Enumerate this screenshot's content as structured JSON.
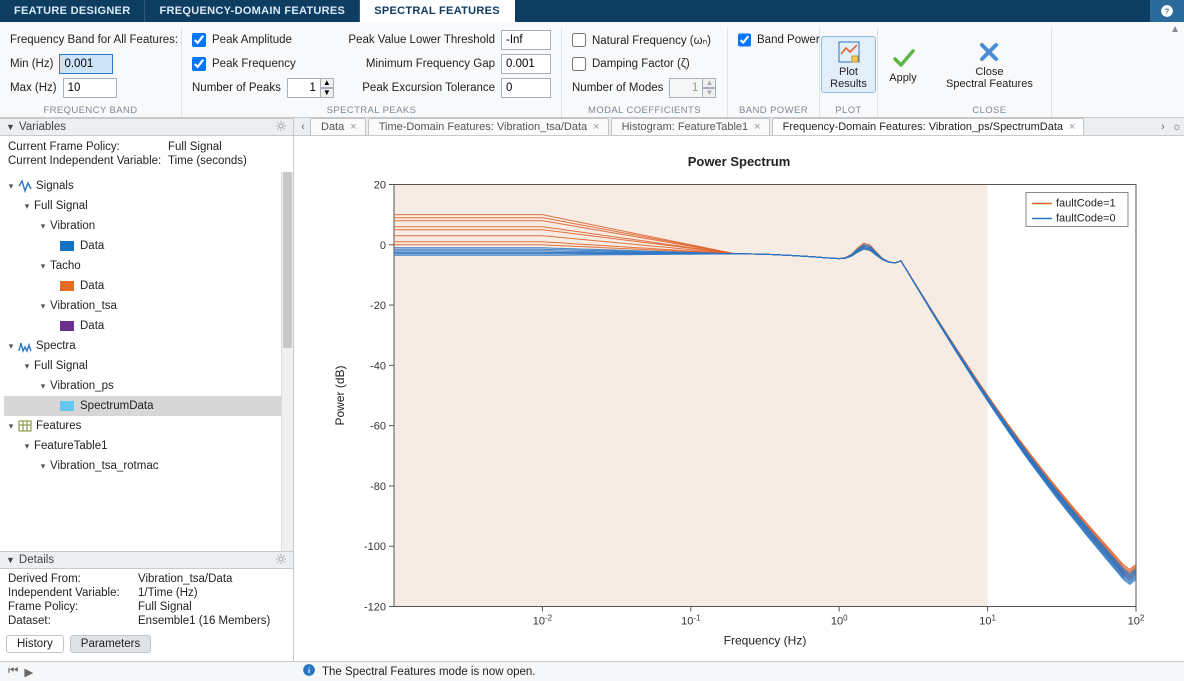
{
  "app_tabs": {
    "feature_designer": "FEATURE DESIGNER",
    "freq_domain": "FREQUENCY-DOMAIN FEATURES",
    "spectral": "SPECTRAL FEATURES"
  },
  "ribbon": {
    "freq_band": {
      "legend": "Frequency Band for All Features:",
      "min_label": "Min (Hz)",
      "min_value": "0.001",
      "max_label": "Max (Hz)",
      "max_value": "10",
      "group_title": "FREQUENCY BAND"
    },
    "spectral_peaks": {
      "group_title": "SPECTRAL PEAKS",
      "peak_amp_label": "Peak Amplitude",
      "peak_amp_checked": true,
      "peak_freq_label": "Peak Frequency",
      "peak_freq_checked": true,
      "num_peaks_label": "Number of Peaks",
      "num_peaks_value": "1",
      "thresh_label": "Peak Value Lower Threshold",
      "thresh_value": "-Inf",
      "gap_label": "Minimum Frequency Gap",
      "gap_value": "0.001",
      "exc_label": "Peak Excursion Tolerance",
      "exc_value": "0"
    },
    "modal": {
      "group_title": "MODAL COEFFICIENTS",
      "natfreq_label": "Natural Frequency (ωₙ)",
      "natfreq_checked": false,
      "damping_label": "Damping Factor (ζ)",
      "damping_checked": false,
      "num_modes_label": "Number of Modes",
      "num_modes_value": "1"
    },
    "band_power": {
      "group_title": "BAND POWER",
      "label": "Band Power",
      "checked": true
    },
    "plot": {
      "group_title": "PLOT",
      "btn_label": "Plot\nResults"
    },
    "apply": {
      "btn_label": "Apply"
    },
    "close": {
      "group_title": "CLOSE",
      "btn_label": "Close\nSpectral Features"
    }
  },
  "variables": {
    "header": "Variables",
    "frame_policy_label": "Current Frame Policy:",
    "frame_policy_value": "Full Signal",
    "indep_label": "Current Independent Variable:",
    "indep_value": "Time (seconds)"
  },
  "tree": {
    "signals": "Signals",
    "full_signal": "Full Signal",
    "vibration": "Vibration",
    "tacho": "Tacho",
    "vib_tsa": "Vibration_tsa",
    "vib_data": "Data",
    "tacho_data": "Data",
    "tsa_data": "Data",
    "spectra": "Spectra",
    "vib_ps": "Vibration_ps",
    "spectrum_data": "SpectrumData",
    "features": "Features",
    "feature_tbl": "FeatureTable1",
    "vib_tsa_rotmac": "Vibration_tsa_rotmac"
  },
  "details": {
    "header": "Details",
    "derived_k": "Derived From:",
    "derived_v": "Vibration_tsa/Data",
    "indep_k": "Independent Variable:",
    "indep_v": "1/Time (Hz)",
    "frame_k": "Frame Policy:",
    "frame_v": "Full Signal",
    "dataset_k": "Dataset:",
    "dataset_v": "Ensemble1 (16 Members)"
  },
  "btm_tabs": {
    "history": "History",
    "parameters": "Parameters"
  },
  "doc_tabs": {
    "t0": "Data",
    "t1": "Time-Domain Features: Vibration_tsa/Data",
    "t2": "Histogram: FeatureTable1",
    "t3": "Frequency-Domain Features: Vibration_ps/SpectrumData"
  },
  "status": {
    "msg": "The Spectral Features mode is now open."
  },
  "chart_data": {
    "type": "line",
    "title": "Power Spectrum",
    "xlabel": "Frequency (Hz)",
    "ylabel": "Power (dB)",
    "xscale": "log",
    "xlim_exp": [
      -3,
      2
    ],
    "ylim": [
      -120,
      20
    ],
    "xticks_exp": [
      -2,
      -1,
      0,
      1,
      2
    ],
    "yticks": [
      -120,
      -100,
      -80,
      -60,
      -40,
      -20,
      0,
      20
    ],
    "legend": {
      "position": "upper-right",
      "entries": [
        "faultCode=1",
        "faultCode=0"
      ]
    },
    "shaded_band_exp": {
      "from": -3,
      "to": 1
    },
    "series_groups": [
      {
        "name": "faultCode=1",
        "color": "#e0642d",
        "count": 8,
        "members": [
          {
            "low_db": 10,
            "plateau_db": -3,
            "peak_db": 0,
            "tail_db": -111.5
          },
          {
            "low_db": 9,
            "plateau_db": -3,
            "peak_db": -1,
            "tail_db": -111
          },
          {
            "low_db": 8,
            "plateau_db": -3,
            "peak_db": -1.5,
            "tail_db": -110.5
          },
          {
            "low_db": 6,
            "plateau_db": -3,
            "peak_db": -2,
            "tail_db": -110
          },
          {
            "low_db": 5,
            "plateau_db": -3,
            "peak_db": -1.5,
            "tail_db": -109.5
          },
          {
            "low_db": 3,
            "plateau_db": -3,
            "peak_db": -2,
            "tail_db": -109
          },
          {
            "low_db": 1,
            "plateau_db": -3,
            "peak_db": -1,
            "tail_db": -108.5
          },
          {
            "low_db": 0,
            "plateau_db": -3,
            "peak_db": -0.5,
            "tail_db": -108
          }
        ]
      },
      {
        "name": "faultCode=0",
        "color": "#2b76c4",
        "count": 8,
        "members": [
          {
            "low_db": -1,
            "plateau_db": -3,
            "peak_db": -0.5,
            "tail_db": -113
          },
          {
            "low_db": -1.5,
            "plateau_db": -3,
            "peak_db": -1,
            "tail_db": -112.5
          },
          {
            "low_db": -2,
            "plateau_db": -3,
            "peak_db": -1.5,
            "tail_db": -112
          },
          {
            "low_db": -2.5,
            "plateau_db": -3,
            "peak_db": -1,
            "tail_db": -111.5
          },
          {
            "low_db": -3,
            "plateau_db": -3,
            "peak_db": -1.5,
            "tail_db": -111
          },
          {
            "low_db": -2.5,
            "plateau_db": -3,
            "peak_db": -2,
            "tail_db": -110.5
          },
          {
            "low_db": -3,
            "plateau_db": -3,
            "peak_db": -1,
            "tail_db": -110
          },
          {
            "low_db": -3.5,
            "plateau_db": -3,
            "peak_db": -2,
            "tail_db": -109.5
          }
        ]
      }
    ]
  }
}
